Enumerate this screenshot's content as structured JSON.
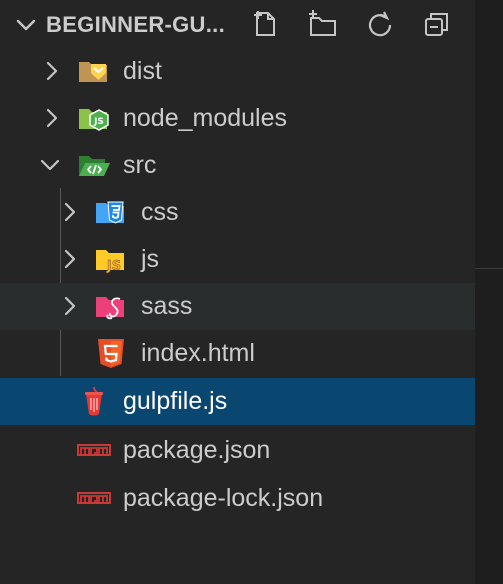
{
  "explorer": {
    "title": "BEGINNER-GU...",
    "actions": [
      {
        "name": "new-file-icon"
      },
      {
        "name": "new-folder-icon"
      },
      {
        "name": "refresh-icon"
      },
      {
        "name": "collapse-all-icon"
      }
    ]
  },
  "tree": {
    "dist": "dist",
    "node_modules": "node_modules",
    "src": "src",
    "css": "css",
    "js": "js",
    "sass": "sass",
    "index_html": "index.html",
    "gulpfile": "gulpfile.js",
    "package_json": "package.json",
    "package_lock": "package-lock.json"
  },
  "colors": {
    "background": "#252526",
    "selected": "#094771",
    "hover": "#2a2d2e",
    "text": "#cccccc"
  }
}
